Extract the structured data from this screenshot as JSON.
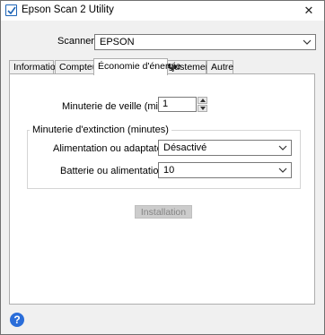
{
  "window": {
    "title": "Epson Scan 2 Utility",
    "close_glyph": "✕"
  },
  "scanner": {
    "label": "Scanner :",
    "value": "EPSON"
  },
  "tabs": [
    {
      "label": "Information"
    },
    {
      "label": "Compteur"
    },
    {
      "label": "Économie d'énergie",
      "active": true
    },
    {
      "label": "Ajustements"
    },
    {
      "label": "Autre"
    }
  ],
  "sleep_timer": {
    "label": "Minuterie de veille (minutes) :",
    "value": "1"
  },
  "power_off": {
    "group_title": "Minuterie d'extinction (minutes)",
    "ac": {
      "label": "Alimentation ou adaptateur CA :",
      "value": "Désactivé"
    },
    "usb": {
      "label": "Batterie ou alimentation USB :",
      "value": "10"
    }
  },
  "install_button": {
    "label": "Installation",
    "enabled": false
  },
  "help": {
    "glyph": "?"
  },
  "colors": {
    "accent": "#2a6dd9",
    "disabled_button": "#cccccc"
  }
}
